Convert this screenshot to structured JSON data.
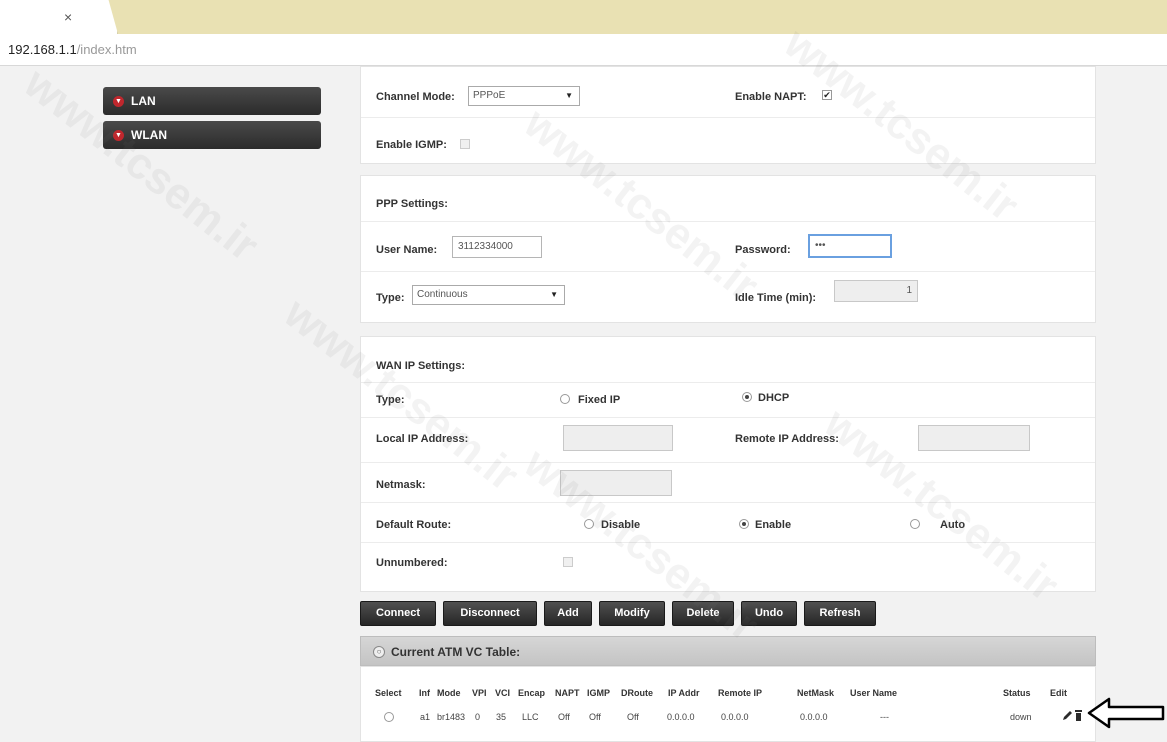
{
  "browser": {
    "tab_close": "×",
    "address_host": "192.168.1.1",
    "address_path": "/index.htm"
  },
  "sidebar": {
    "items": [
      {
        "label": "LAN"
      },
      {
        "label": "WLAN"
      }
    ]
  },
  "connection": {
    "channel_mode_label": "Channel Mode:",
    "channel_mode_value": "PPPoE",
    "enable_napt_label": "Enable NAPT:",
    "enable_napt_checked": "✔",
    "enable_igmp_label": "Enable IGMP:"
  },
  "ppp": {
    "section_title": "PPP Settings:",
    "username_label": "User Name:",
    "username_value": "3112334000",
    "password_label": "Password:",
    "password_value": "•••",
    "type_label": "Type:",
    "type_value": "Continuous",
    "idle_label": "Idle Time (min):",
    "idle_value": "1"
  },
  "wan": {
    "section_title": "WAN IP Settings:",
    "type_label": "Type:",
    "type_fixed": "Fixed IP",
    "type_dhcp": "DHCP",
    "local_ip_label": "Local IP Address:",
    "remote_ip_label": "Remote IP Address:",
    "netmask_label": "Netmask:",
    "default_route_label": "Default Route:",
    "route_disable": "Disable",
    "route_enable": "Enable",
    "route_auto": "Auto",
    "unnumbered_label": "Unnumbered:"
  },
  "actions": {
    "connect": "Connect",
    "disconnect": "Disconnect",
    "add": "Add",
    "modify": "Modify",
    "delete": "Delete",
    "undo": "Undo",
    "refresh": "Refresh"
  },
  "atm_table": {
    "title": "Current ATM VC Table:",
    "columns": [
      "Select",
      "Inf",
      "Mode",
      "VPI",
      "VCI",
      "Encap",
      "NAPT",
      "IGMP",
      "DRoute",
      "IP Addr",
      "Remote IP",
      "NetMask",
      "User Name",
      "Status",
      "Edit"
    ],
    "row": {
      "inf": "a1",
      "mode": "br1483",
      "vpi": "0",
      "vci": "35",
      "encap": "LLC",
      "napt": "Off",
      "igmp": "Off",
      "droute": "Off",
      "ip_addr": "0.0.0.0",
      "remote_ip": "0.0.0.0",
      "netmask": "0.0.0.0",
      "user_name": "---",
      "status": "down"
    }
  },
  "watermark_text": "www.tcsem.ir",
  "colors": {
    "menu_bg": "#2b2b2b",
    "menu_dot": "#c0272d",
    "button_bg": "#333333",
    "tab_strip": "#e9e1b3"
  }
}
